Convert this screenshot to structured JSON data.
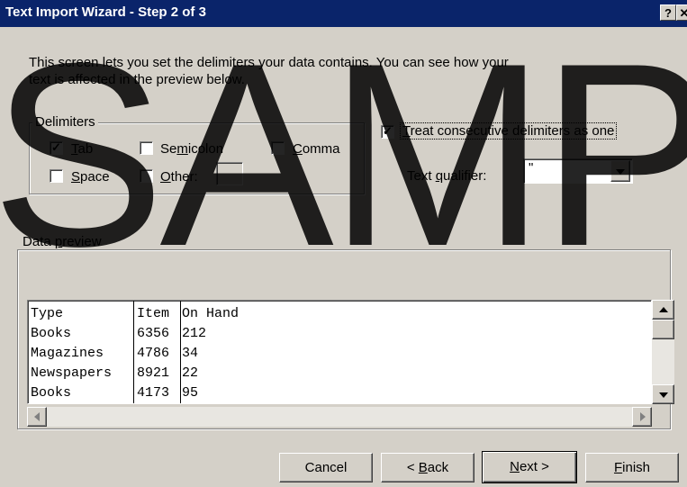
{
  "window": {
    "title": "Text Import Wizard - Step 2 of 3",
    "help_label": "?",
    "close_label": "✕"
  },
  "intro": {
    "text": "This screen lets you set the delimiters your data contains.  You can see how your text is affected in the preview below."
  },
  "delimiters": {
    "legend": "Delimiters",
    "tab": {
      "label_pre": "",
      "accel": "T",
      "label_post": "ab",
      "checked": true
    },
    "semicolon": {
      "label_pre": "Se",
      "accel": "m",
      "label_post": "icolon",
      "checked": false
    },
    "comma": {
      "label_pre": "",
      "accel": "C",
      "label_post": "omma",
      "checked": false
    },
    "space": {
      "label_pre": "",
      "accel": "S",
      "label_post": "pace",
      "checked": false
    },
    "other": {
      "label_pre": "",
      "accel": "O",
      "label_post": "ther:",
      "checked": false,
      "value": ""
    }
  },
  "consecutive": {
    "label_pre": "",
    "accel": "T",
    "label_post": "reat consecutive delimiters as one",
    "checked": true
  },
  "qualifier": {
    "label_pre": "Text ",
    "accel": "q",
    "label_post": "ualifier:",
    "value": "\""
  },
  "preview": {
    "legend_pre": "Data ",
    "legend_accel": "p",
    "legend_post": "review",
    "columns": [
      [
        "Type",
        "Books",
        "Magazines",
        "Newspapers",
        "Books"
      ],
      [
        "Item",
        "6356",
        "4786",
        "8921",
        "4173"
      ],
      [
        "On Hand",
        "212",
        "34",
        "22",
        "95"
      ]
    ]
  },
  "buttons": {
    "cancel": "Cancel",
    "back_pre": "< ",
    "back_accel": "B",
    "back_post": "ack",
    "next_pre": "",
    "next_accel": "N",
    "next_post": "ext >",
    "finish_pre": "",
    "finish_accel": "F",
    "finish_post": "inish"
  },
  "watermark": "SAMP",
  "colors": {
    "titlebar": "#0a246a",
    "face": "#d4d0c8"
  }
}
